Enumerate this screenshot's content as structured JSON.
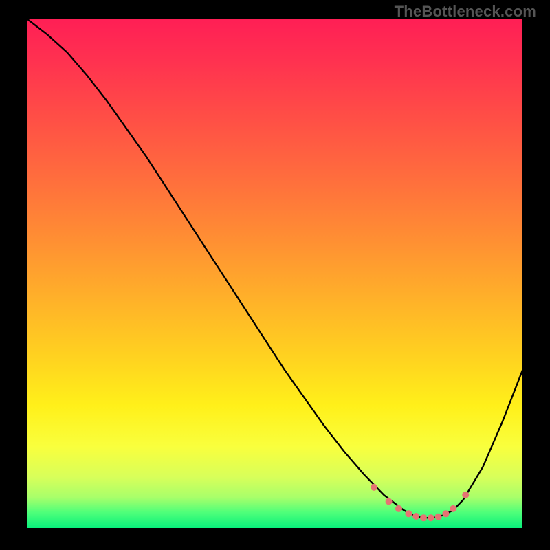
{
  "watermark": "TheBottleneck.com",
  "chart_data": {
    "type": "line",
    "title": "",
    "xlabel": "",
    "ylabel": "",
    "xlim": [
      0,
      100
    ],
    "ylim": [
      0,
      100
    ],
    "grid": false,
    "series": [
      {
        "name": "bottleneck-curve",
        "x": [
          0,
          4,
          8,
          12,
          16,
          20,
          24,
          28,
          32,
          36,
          40,
          44,
          48,
          52,
          56,
          60,
          64,
          68,
          72,
          74,
          76,
          78,
          80,
          82,
          84,
          86,
          88,
          92,
          96,
          100
        ],
        "y": [
          100,
          97,
          93.5,
          89,
          84,
          78.5,
          73,
          67,
          61,
          55,
          49,
          43,
          37,
          31,
          25.5,
          20,
          15,
          10.5,
          6.5,
          5,
          3.5,
          2.5,
          2,
          2,
          2.5,
          3.5,
          5.5,
          12,
          21,
          31
        ]
      }
    ],
    "dots": {
      "name": "marker-dots",
      "color": "#e57373",
      "points": [
        {
          "x": 70,
          "y": 8
        },
        {
          "x": 73,
          "y": 5.2
        },
        {
          "x": 75,
          "y": 3.8
        },
        {
          "x": 77,
          "y": 2.8
        },
        {
          "x": 78.5,
          "y": 2.3
        },
        {
          "x": 80,
          "y": 2.0
        },
        {
          "x": 81.5,
          "y": 2.0
        },
        {
          "x": 83,
          "y": 2.2
        },
        {
          "x": 84.5,
          "y": 2.8
        },
        {
          "x": 86,
          "y": 3.8
        },
        {
          "x": 88.5,
          "y": 6.5
        }
      ]
    },
    "gradient_stops": [
      {
        "pct": 0,
        "color": "#ff1f55"
      },
      {
        "pct": 18,
        "color": "#ff4b47"
      },
      {
        "pct": 42,
        "color": "#ff8b34"
      },
      {
        "pct": 66,
        "color": "#ffd120"
      },
      {
        "pct": 84,
        "color": "#f9ff3d"
      },
      {
        "pct": 94,
        "color": "#a8ff6a"
      },
      {
        "pct": 100,
        "color": "#08f07b"
      }
    ]
  }
}
